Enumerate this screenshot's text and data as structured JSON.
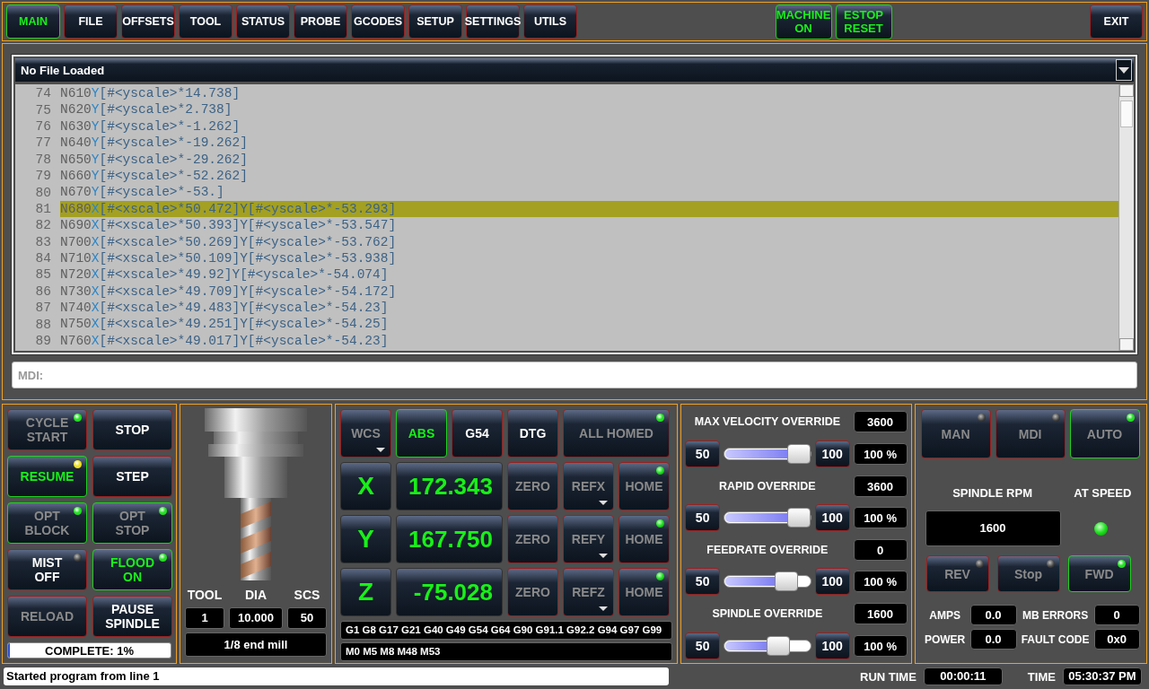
{
  "nav_tabs": [
    {
      "label": "MAIN",
      "selected": true
    },
    {
      "label": "FILE",
      "selected": false
    },
    {
      "label": "OFFSETS",
      "selected": false
    },
    {
      "label": "TOOL",
      "selected": false
    },
    {
      "label": "STATUS",
      "selected": false
    },
    {
      "label": "PROBE",
      "selected": false
    },
    {
      "label": "GCODES",
      "selected": false
    },
    {
      "label": "SETUP",
      "selected": false
    },
    {
      "label": "SETTINGS",
      "selected": false
    },
    {
      "label": "UTILS",
      "selected": false
    }
  ],
  "machine_buttons": [
    {
      "label": "MACHINE\nON",
      "selected": true
    },
    {
      "label": "ESTOP\nRESET",
      "selected": true
    }
  ],
  "exit_button": {
    "label": "EXIT"
  },
  "file": {
    "name": "No File Loaded"
  },
  "code": {
    "lines": [
      {
        "number": "74",
        "selected": false,
        "segments": [
          {
            "kind": "word",
            "text": "N610"
          },
          {
            "kind": "axis",
            "text": "Y"
          },
          {
            "kind": "expr",
            "text": "[#<yscale>*14.738]"
          }
        ]
      },
      {
        "number": "75",
        "selected": false,
        "segments": [
          {
            "kind": "word",
            "text": "N620"
          },
          {
            "kind": "axis",
            "text": "Y"
          },
          {
            "kind": "expr",
            "text": "[#<yscale>*2.738]"
          }
        ]
      },
      {
        "number": "76",
        "selected": false,
        "segments": [
          {
            "kind": "word",
            "text": "N630"
          },
          {
            "kind": "axis",
            "text": "Y"
          },
          {
            "kind": "expr",
            "text": "[#<yscale>*-1.262]"
          }
        ]
      },
      {
        "number": "77",
        "selected": false,
        "segments": [
          {
            "kind": "word",
            "text": "N640"
          },
          {
            "kind": "axis",
            "text": "Y"
          },
          {
            "kind": "expr",
            "text": "[#<yscale>*-19.262]"
          }
        ]
      },
      {
        "number": "78",
        "selected": false,
        "segments": [
          {
            "kind": "word",
            "text": "N650"
          },
          {
            "kind": "axis",
            "text": "Y"
          },
          {
            "kind": "expr",
            "text": "[#<yscale>*-29.262]"
          }
        ]
      },
      {
        "number": "79",
        "selected": false,
        "segments": [
          {
            "kind": "word",
            "text": "N660"
          },
          {
            "kind": "axis",
            "text": "Y"
          },
          {
            "kind": "expr",
            "text": "[#<yscale>*-52.262]"
          }
        ]
      },
      {
        "number": "80",
        "selected": false,
        "segments": [
          {
            "kind": "word",
            "text": "N670"
          },
          {
            "kind": "axis",
            "text": "Y"
          },
          {
            "kind": "expr",
            "text": "[#<yscale>*-53.]"
          }
        ]
      },
      {
        "number": "81",
        "selected": true,
        "segments": [
          {
            "kind": "word",
            "text": "N680"
          },
          {
            "kind": "axis",
            "text": "X"
          },
          {
            "kind": "expr",
            "text": "[#<xscale>*50.472]Y[#<yscale>*-53.293]"
          }
        ]
      },
      {
        "number": "82",
        "selected": false,
        "segments": [
          {
            "kind": "word",
            "text": "N690"
          },
          {
            "kind": "axis",
            "text": "X"
          },
          {
            "kind": "expr",
            "text": "[#<xscale>*50.393]Y[#<yscale>*-53.547]"
          }
        ]
      },
      {
        "number": "83",
        "selected": false,
        "segments": [
          {
            "kind": "word",
            "text": "N700"
          },
          {
            "kind": "axis",
            "text": "X"
          },
          {
            "kind": "expr",
            "text": "[#<xscale>*50.269]Y[#<yscale>*-53.762]"
          }
        ]
      },
      {
        "number": "84",
        "selected": false,
        "segments": [
          {
            "kind": "word",
            "text": "N710"
          },
          {
            "kind": "axis",
            "text": "X"
          },
          {
            "kind": "expr",
            "text": "[#<xscale>*50.109]Y[#<yscale>*-53.938]"
          }
        ]
      },
      {
        "number": "85",
        "selected": false,
        "segments": [
          {
            "kind": "word",
            "text": "N720"
          },
          {
            "kind": "axis",
            "text": "X"
          },
          {
            "kind": "expr",
            "text": "[#<xscale>*49.92]Y[#<yscale>*-54.074]"
          }
        ]
      },
      {
        "number": "86",
        "selected": false,
        "segments": [
          {
            "kind": "word",
            "text": "N730"
          },
          {
            "kind": "axis",
            "text": "X"
          },
          {
            "kind": "expr",
            "text": "[#<xscale>*49.709]Y[#<yscale>*-54.172]"
          }
        ]
      },
      {
        "number": "87",
        "selected": false,
        "segments": [
          {
            "kind": "word",
            "text": "N740"
          },
          {
            "kind": "axis",
            "text": "X"
          },
          {
            "kind": "expr",
            "text": "[#<xscale>*49.483]Y[#<yscale>*-54.23]"
          }
        ]
      },
      {
        "number": "88",
        "selected": false,
        "segments": [
          {
            "kind": "word",
            "text": "N750"
          },
          {
            "kind": "axis",
            "text": "X"
          },
          {
            "kind": "expr",
            "text": "[#<xscale>*49.251]Y[#<yscale>*-54.25]"
          }
        ]
      },
      {
        "number": "89",
        "selected": false,
        "segments": [
          {
            "kind": "word",
            "text": "N760"
          },
          {
            "kind": "axis",
            "text": "X"
          },
          {
            "kind": "expr",
            "text": "[#<xscale>*49.017]Y[#<yscale>*-54.23]"
          }
        ]
      }
    ]
  },
  "mdi": {
    "placeholder": "MDI:"
  },
  "program_controls": [
    {
      "label": "CYCLE\nSTART",
      "selected": false,
      "disabled": true,
      "led": {
        "on": true,
        "color": "#22e022"
      }
    },
    {
      "label": "STOP",
      "selected": false,
      "disabled": false
    },
    {
      "label": "RESUME",
      "selected": true,
      "disabled": false,
      "led": {
        "on": true,
        "color": "#f0e020"
      }
    },
    {
      "label": "STEP",
      "selected": false,
      "disabled": false
    },
    {
      "label": "OPT\nBLOCK",
      "selected": true,
      "disabled": true,
      "led": {
        "on": true,
        "color": "#22e022"
      }
    },
    {
      "label": "OPT\nSTOP",
      "selected": true,
      "disabled": true,
      "led": {
        "on": true,
        "color": "#22e022"
      }
    },
    {
      "label": "MIST\nOFF",
      "selected": false,
      "disabled": false,
      "led": {
        "on": false
      }
    },
    {
      "label": "FLOOD\nON",
      "selected": true,
      "disabled": false,
      "led": {
        "on": true,
        "color": "#22e022"
      }
    },
    {
      "label": "RELOAD",
      "selected": false,
      "disabled": true
    },
    {
      "label": "PAUSE\nSPINDLE",
      "selected": false,
      "disabled": false
    }
  ],
  "progress": {
    "label": "COMPLETE: 1%",
    "level": 0.01
  },
  "tool": {
    "headers": [
      "TOOL",
      "DIA",
      "SCS"
    ],
    "values": [
      "1",
      "10.000",
      "50"
    ],
    "description": "1/8 end mill"
  },
  "dro": {
    "mode_buttons": [
      {
        "label": "WCS",
        "selected": false,
        "disabled": true,
        "caret": true
      },
      {
        "label": "ABS",
        "selected": true,
        "disabled": false,
        "caret": false
      },
      {
        "label": "G54",
        "selected": false,
        "disabled": false,
        "caret": false
      },
      {
        "label": "DTG",
        "selected": false,
        "disabled": false,
        "caret": false
      },
      {
        "label": "ALL HOMED",
        "selected": false,
        "disabled": true,
        "caret": false,
        "led": {
          "on": true,
          "color": "#22e022"
        }
      }
    ],
    "axes": [
      {
        "axis": "X",
        "value": "172.343",
        "zero": "ZERO",
        "ref": "REFX",
        "home": "HOME",
        "homed": true
      },
      {
        "axis": "Y",
        "value": "167.750",
        "zero": "ZERO",
        "ref": "REFY",
        "home": "HOME",
        "homed": true
      },
      {
        "axis": "Z",
        "value": "-75.028",
        "zero": "ZERO",
        "ref": "REFZ",
        "home": "HOME",
        "homed": true
      }
    ],
    "active_gcodes": "G1 G8 G17 G21 G40 G49 G54 G64 G90 G91.1 G92.2 G94 G97 G99",
    "active_mcodes": "M0 M5 M8 M48 M53"
  },
  "overrides": [
    {
      "label": "MAX VELOCITY OVERRIDE",
      "value": "3600",
      "min": "50",
      "max": "100",
      "level": 1,
      "percent": "100 %"
    },
    {
      "label": "RAPID OVERRIDE",
      "value": "3600",
      "min": "50",
      "max": "100",
      "level": 1,
      "percent": "100 %"
    },
    {
      "label": "FEEDRATE OVERRIDE",
      "value": "0",
      "min": "50",
      "max": "100",
      "level": 0.8,
      "percent": "100 %"
    },
    {
      "label": "SPINDLE OVERRIDE",
      "value": "1600",
      "min": "50",
      "max": "100",
      "level": 0.68,
      "percent": "100 %"
    }
  ],
  "spindle": {
    "modes": [
      {
        "label": "MAN",
        "selected": false,
        "disabled": true,
        "led": {
          "on": false
        }
      },
      {
        "label": "MDI",
        "selected": false,
        "disabled": true,
        "led": {
          "on": false
        }
      },
      {
        "label": "AUTO",
        "selected": true,
        "disabled": true,
        "led": {
          "on": true,
          "color": "#22e022"
        }
      }
    ],
    "rpm_label": "SPINDLE RPM",
    "rpm": "1600",
    "at_speed_label": "AT SPEED",
    "at_speed": true,
    "direction_buttons": [
      {
        "label": "REV",
        "selected": false,
        "disabled": true,
        "led": {
          "on": false
        }
      },
      {
        "label": "Stop",
        "selected": false,
        "disabled": true,
        "led": {
          "on": false
        }
      },
      {
        "label": "FWD",
        "selected": true,
        "disabled": true,
        "led": {
          "on": true,
          "color": "#22e022"
        }
      }
    ],
    "readouts": [
      {
        "label": "AMPS",
        "value": "0.0"
      },
      {
        "label": "MB ERRORS",
        "value": "0"
      },
      {
        "label": "POWER",
        "value": "0.0"
      },
      {
        "label": "FAULT CODE",
        "value": "0x0"
      }
    ]
  },
  "status_bar": {
    "message": "Started program from line 1",
    "run_time_label": "RUN TIME",
    "run_time": "00:00:11",
    "time_label": "TIME",
    "time": "05:30:37 PM"
  }
}
